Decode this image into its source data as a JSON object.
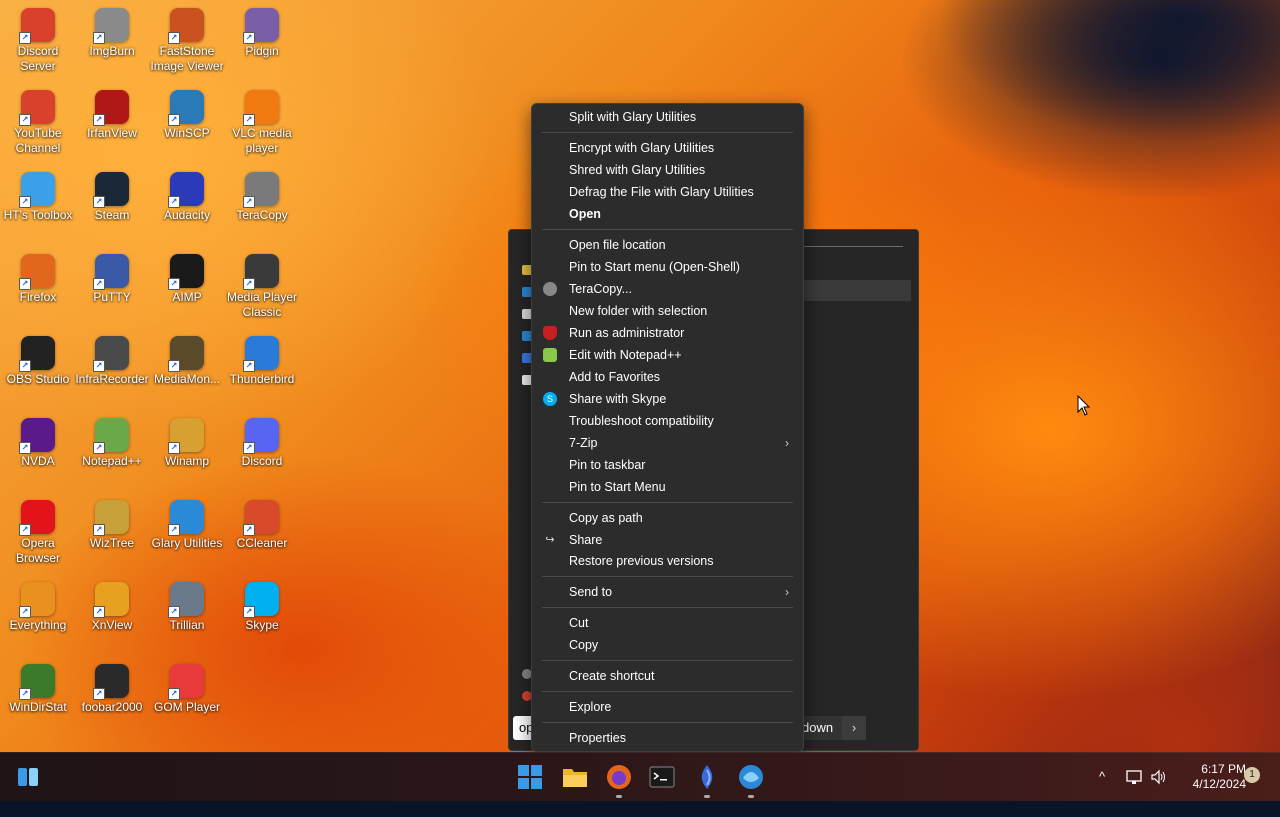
{
  "desktop": {
    "icons": [
      {
        "label": "Discord Server",
        "icon": "chrome-icon",
        "color": "#d9412c"
      },
      {
        "label": "ImgBurn",
        "icon": "imgburn-icon",
        "color": "#8a8a8a"
      },
      {
        "label": "FastStone Image Viewer",
        "icon": "faststone-icon",
        "color": "#c9521f"
      },
      {
        "label": "Pidgin",
        "icon": "pidgin-icon",
        "color": "#7a5fa8"
      },
      {
        "label": "YouTube Channel",
        "icon": "chrome-icon",
        "color": "#d9412c"
      },
      {
        "label": "IrfanView",
        "icon": "irfanview-icon",
        "color": "#b01818"
      },
      {
        "label": "WinSCP",
        "icon": "winscp-icon",
        "color": "#2a7ab8"
      },
      {
        "label": "VLC media player",
        "icon": "vlc-icon",
        "color": "#f07a10"
      },
      {
        "label": "HT's Toolbox",
        "icon": "folder-icon",
        "color": "#3aa0e8"
      },
      {
        "label": "Steam",
        "icon": "steam-icon",
        "color": "#1b2838"
      },
      {
        "label": "Audacity",
        "icon": "audacity-icon",
        "color": "#2a3ab8"
      },
      {
        "label": "TeraCopy",
        "icon": "teracopy-icon",
        "color": "#7a7a7a"
      },
      {
        "label": "Firefox",
        "icon": "firefox-icon",
        "color": "#e2671d"
      },
      {
        "label": "PuTTY",
        "icon": "putty-icon",
        "color": "#3a5aa8"
      },
      {
        "label": "AIMP",
        "icon": "aimp-icon",
        "color": "#1a1a1a"
      },
      {
        "label": "Media Player Classic",
        "icon": "mpc-icon",
        "color": "#3a3a3a"
      },
      {
        "label": "OBS Studio",
        "icon": "obs-icon",
        "color": "#222222"
      },
      {
        "label": "InfraRecorder",
        "icon": "infrarecorder-icon",
        "color": "#4a4a4a"
      },
      {
        "label": "MediaMon...",
        "icon": "mediamonkey-icon",
        "color": "#5a4a2a"
      },
      {
        "label": "Thunderbird",
        "icon": "thunderbird-icon",
        "color": "#2a7ad8"
      },
      {
        "label": "NVDA",
        "icon": "nvda-icon",
        "color": "#5a1a8a"
      },
      {
        "label": "Notepad++",
        "icon": "notepadpp-icon",
        "color": "#6aa84a"
      },
      {
        "label": "Winamp",
        "icon": "winamp-icon",
        "color": "#d8a030"
      },
      {
        "label": "Discord",
        "icon": "discord-icon",
        "color": "#5865f2"
      },
      {
        "label": "Opera Browser",
        "icon": "opera-icon",
        "color": "#e3131b"
      },
      {
        "label": "WizTree",
        "icon": "wiztree-icon",
        "color": "#c8a03a"
      },
      {
        "label": "Glary Utilities",
        "icon": "glary-icon",
        "color": "#2a8ad8"
      },
      {
        "label": "CCleaner",
        "icon": "ccleaner-icon",
        "color": "#d84a2a"
      },
      {
        "label": "Everything",
        "icon": "everything-icon",
        "color": "#e89020"
      },
      {
        "label": "XnView",
        "icon": "xnview-icon",
        "color": "#e8a020"
      },
      {
        "label": "Trillian",
        "icon": "trillian-icon",
        "color": "#6a7a8a"
      },
      {
        "label": "Skype",
        "icon": "skype-icon",
        "color": "#00aff0"
      },
      {
        "label": "WinDirStat",
        "icon": "windirstat-icon",
        "color": "#3a7a2a"
      },
      {
        "label": "foobar2000",
        "icon": "foobar-icon",
        "color": "#2a2a2a"
      },
      {
        "label": "GOM Player",
        "icon": "gom-icon",
        "color": "#e83a3a"
      }
    ]
  },
  "start_menu": {
    "search_value": "op",
    "shutdown_label": "down",
    "shutdown_chevron": "›"
  },
  "context_menu": {
    "items": [
      {
        "label": "Split with Glary Utilities"
      },
      {
        "label": "Encrypt with Glary Utilities"
      },
      {
        "label": "Shred with Glary Utilities"
      },
      {
        "label": "Defrag the File with Glary Utilities"
      },
      {
        "label": "Open"
      },
      {
        "label": "Open file location"
      },
      {
        "label": "Pin to Start menu (Open-Shell)"
      },
      {
        "label": "TeraCopy..."
      },
      {
        "label": "New folder with selection"
      },
      {
        "label": "Run as administrator"
      },
      {
        "label": "Edit with Notepad++"
      },
      {
        "label": "Add to Favorites"
      },
      {
        "label": "Share with Skype"
      },
      {
        "label": "Troubleshoot compatibility"
      },
      {
        "label": "7-Zip"
      },
      {
        "label": "Pin to taskbar"
      },
      {
        "label": "Pin to Start Menu"
      },
      {
        "label": "Copy as path"
      },
      {
        "label": "Share"
      },
      {
        "label": "Restore previous versions"
      },
      {
        "label": "Send to"
      },
      {
        "label": "Cut"
      },
      {
        "label": "Copy"
      },
      {
        "label": "Create shortcut"
      },
      {
        "label": "Explore"
      },
      {
        "label": "Properties"
      }
    ],
    "submenu_glyph": "›"
  },
  "taskbar": {
    "apps": [
      {
        "name": "start-button",
        "color": "#3a8ee8"
      },
      {
        "name": "file-explorer",
        "color": "#f0b429"
      },
      {
        "name": "firefox",
        "color": "#e2671d"
      },
      {
        "name": "terminal",
        "color": "#1a1a1a"
      },
      {
        "name": "app-drop",
        "color": "#3a6ad8"
      },
      {
        "name": "glary-utilities",
        "color": "#2a8ad8"
      }
    ],
    "clock_time": "6:17 PM",
    "clock_date": "4/12/2024",
    "notification_count": "1",
    "tray_chevron": "^"
  }
}
